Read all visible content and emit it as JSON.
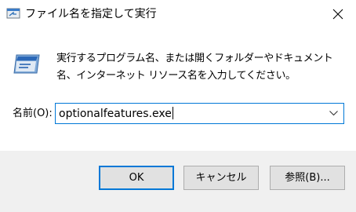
{
  "window": {
    "title": "ファイル名を指定して実行",
    "close_label": "close"
  },
  "content": {
    "description": "実行するプログラム名、または開くフォルダーやドキュメント名、インターネット リソース名を入力してください。",
    "open_label": "名前(O):",
    "open_value": "optionalfeatures.exe"
  },
  "buttons": {
    "ok": "OK",
    "cancel": "キャンセル",
    "browse": "参照(B)..."
  },
  "colors": {
    "accent": "#0078d7",
    "footer_bg": "#f0f0f0",
    "button_bg": "#e1e1e1"
  },
  "icons": {
    "title": "run-dialog-icon",
    "main": "run-program-icon",
    "close": "close-icon",
    "dropdown": "chevron-down-icon"
  }
}
